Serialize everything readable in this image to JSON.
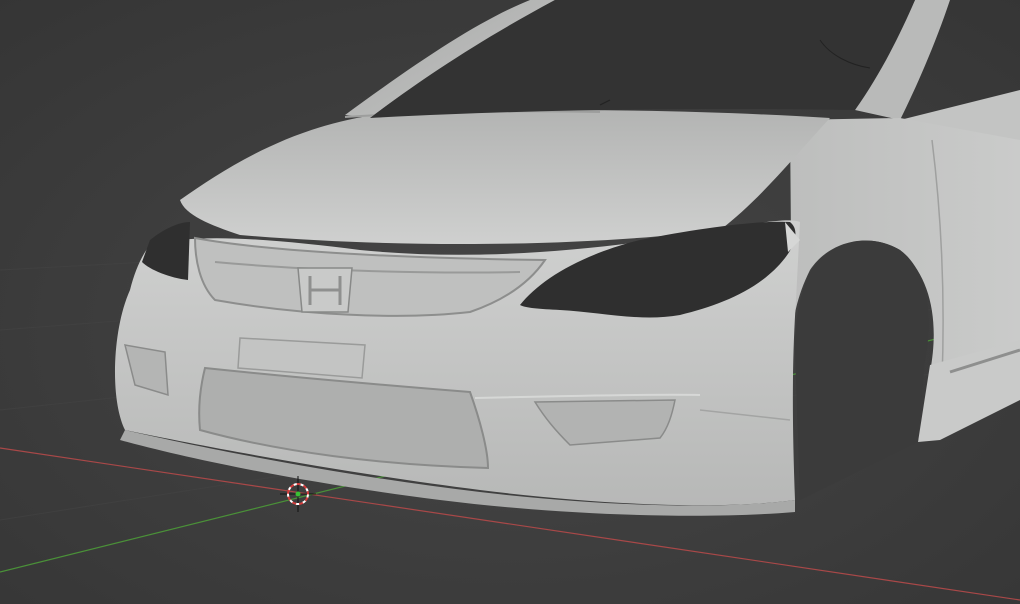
{
  "viewport": {
    "mode": "solid-shading",
    "background_color": "#3d3d3d",
    "model_color": "#c7c7c7",
    "axis_colors": {
      "x": "#b94a4a",
      "y": "#4d9a3a"
    }
  },
  "scene": {
    "object": "car-front-body-mesh",
    "badge": "h-emblem",
    "cursor": "3d-cursor"
  },
  "icons": {
    "cursor_icon": "3d-cursor-icon"
  }
}
